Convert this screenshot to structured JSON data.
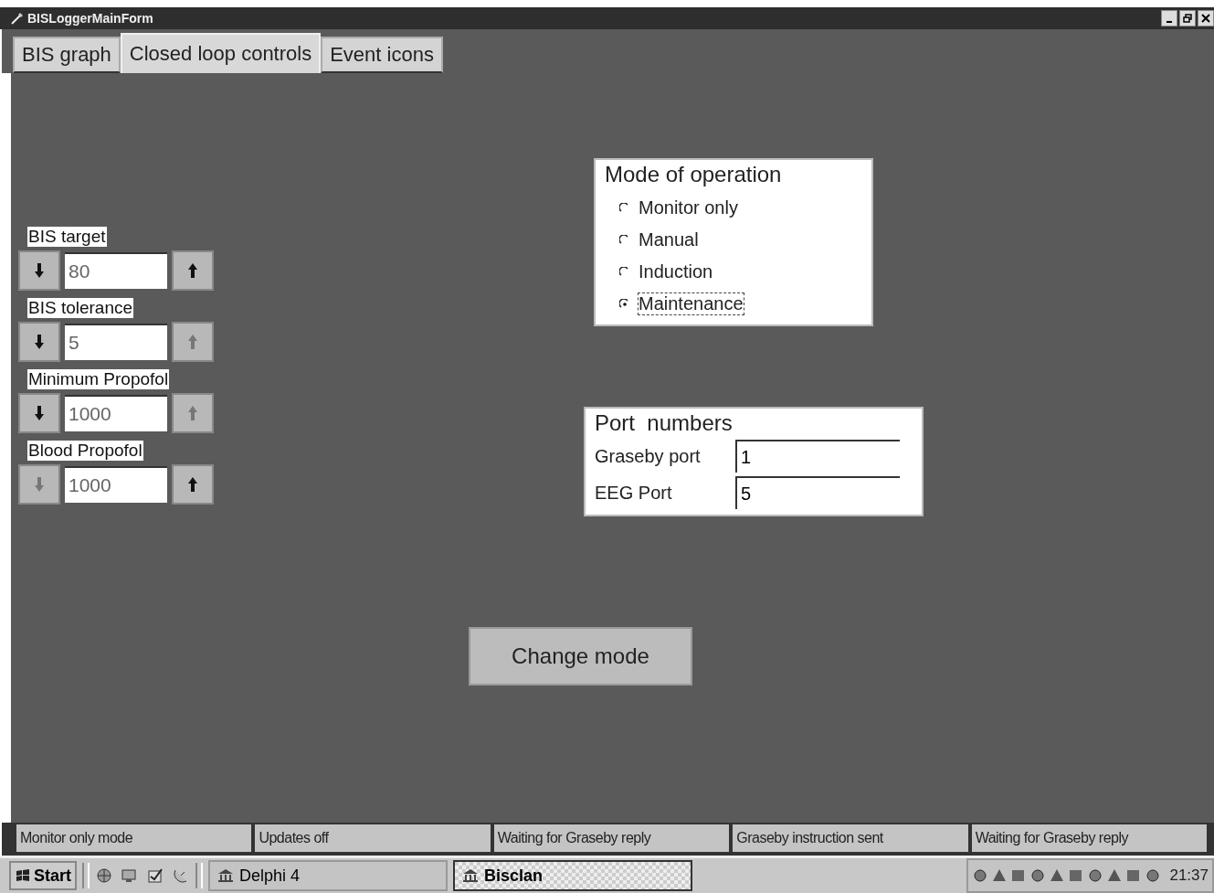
{
  "window": {
    "title": "BISLoggerMainForm"
  },
  "tabs": [
    {
      "label": "BIS graph",
      "selected": false
    },
    {
      "label": "Closed loop controls",
      "selected": true
    },
    {
      "label": "Event icons",
      "selected": false
    }
  ],
  "spinners": [
    {
      "label": "BIS target",
      "value": "80",
      "down_enabled": true,
      "up_enabled": true
    },
    {
      "label": "BIS tolerance",
      "value": "5",
      "down_enabled": true,
      "up_enabled": false
    },
    {
      "label": "Minimum Propofol",
      "value": "1000",
      "down_enabled": true,
      "up_enabled": false
    },
    {
      "label": "Blood Propofol",
      "value": "1000",
      "down_enabled": false,
      "up_enabled": true
    }
  ],
  "mode_group": {
    "title": "Mode of operation",
    "options": [
      {
        "label": "Monitor only",
        "selected": false,
        "focused": false
      },
      {
        "label": "Manual",
        "selected": false,
        "focused": false
      },
      {
        "label": "Induction",
        "selected": false,
        "focused": false
      },
      {
        "label": "Maintenance",
        "selected": true,
        "focused": true
      }
    ]
  },
  "port_group": {
    "title": "Port  numbers",
    "fields": [
      {
        "label": "Graseby port",
        "value": "1"
      },
      {
        "label": "EEG Port",
        "value": "5"
      }
    ]
  },
  "action_button": "Change mode",
  "status_bar": [
    "Monitor only mode",
    "Updates off",
    "Waiting for Graseby reply",
    "Graseby instruction sent",
    "Waiting for Graseby reply"
  ],
  "taskbar": {
    "start": "Start",
    "tasks": [
      {
        "label": "Delphi 4",
        "selected": false
      },
      {
        "label": "Bisclan",
        "selected": true
      }
    ],
    "clock": "21:37"
  }
}
